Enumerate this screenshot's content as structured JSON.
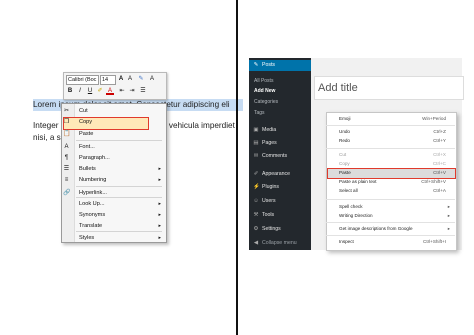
{
  "left": {
    "doc_line1": "Lorem ipsum dolor sit amet, Consectetur adipiscing eli",
    "doc_line2": "Integer c",
    "doc_line2b": "vehicula imperdiet",
    "doc_line3": "nisi, a so",
    "toolbar": {
      "font_name": "Calibri (Boc",
      "font_size": "14",
      "bold": "B",
      "italic": "I",
      "underline": "U",
      "font_color": "A"
    },
    "menu": {
      "items": [
        {
          "icon": "scissors-icon",
          "glyph": "✂",
          "label": "Cut",
          "u": 0
        },
        {
          "icon": "copy-icon",
          "glyph": "❐",
          "label": "Copy",
          "u": 0
        },
        {
          "icon": "paste-icon",
          "glyph": "📋",
          "label": "Paste",
          "u": 0
        },
        {
          "icon": "font-icon",
          "glyph": "A",
          "label": "Font..."
        },
        {
          "icon": "paragraph-icon",
          "glyph": "¶",
          "label": "Paragraph..."
        },
        {
          "icon": "bullets-icon",
          "glyph": "☰",
          "label": "Bullets",
          "submenu": true
        },
        {
          "icon": "numbering-icon",
          "glyph": "≡",
          "label": "Numbering",
          "submenu": true
        },
        {
          "icon": "hyperlink-icon",
          "glyph": "🔗",
          "label": "Hyperlink..."
        },
        {
          "icon": "lookup-icon",
          "glyph": "",
          "label": "Look Up...",
          "submenu": true
        },
        {
          "icon": "synonyms-icon",
          "glyph": "",
          "label": "Synonyms",
          "submenu": true
        },
        {
          "icon": "translate-icon",
          "glyph": "",
          "label": "Translate",
          "submenu": true
        },
        {
          "icon": "styles-icon",
          "glyph": "",
          "label": "Styles",
          "submenu": true
        }
      ],
      "submenu_arrow": "▸"
    }
  },
  "right": {
    "sidebar": {
      "posts": "Posts",
      "all_posts": "All Posts",
      "add_new": "Add New",
      "categories": "Categories",
      "tags": "Tags",
      "media": "Media",
      "pages": "Pages",
      "comments": "Comments",
      "appearance": "Appearance",
      "plugins": "Plugins",
      "users": "Users",
      "tools": "Tools",
      "settings": "Settings",
      "collapse": "Collapse menu"
    },
    "editor_title_placeholder": "Add title",
    "context_menu": {
      "items": [
        {
          "label": "Emoji",
          "shortcut": "Win+Period",
          "disabled": false
        },
        {
          "label": "Undo",
          "shortcut": "Ctrl+Z",
          "disabled": false
        },
        {
          "label": "Redo",
          "shortcut": "Ctrl+Y",
          "disabled": false
        },
        {
          "label": "Cut",
          "shortcut": "Ctrl+X",
          "disabled": true
        },
        {
          "label": "Copy",
          "shortcut": "Ctrl+C",
          "disabled": true
        },
        {
          "label": "Paste",
          "shortcut": "Ctrl+V",
          "disabled": false
        },
        {
          "label": "Paste as plain text",
          "shortcut": "Ctrl+Shift+V",
          "disabled": false
        },
        {
          "label": "Select all",
          "shortcut": "Ctrl+A",
          "disabled": false
        },
        {
          "label": "Spell check",
          "shortcut": "",
          "disabled": false,
          "submenu": true
        },
        {
          "label": "Writing Direction",
          "shortcut": "",
          "disabled": false,
          "submenu": true
        },
        {
          "label": "Get image descriptions from Google",
          "shortcut": "",
          "disabled": false,
          "submenu": true
        },
        {
          "label": "Inspect",
          "shortcut": "Ctrl+Shift+I",
          "disabled": false
        }
      ],
      "submenu_arrow": "▸"
    }
  },
  "colors": {
    "selection": "#c7dcf3",
    "highlight_border": "#e03a2c",
    "wp_sidebar": "#23282d",
    "wp_active": "#0073aa"
  }
}
